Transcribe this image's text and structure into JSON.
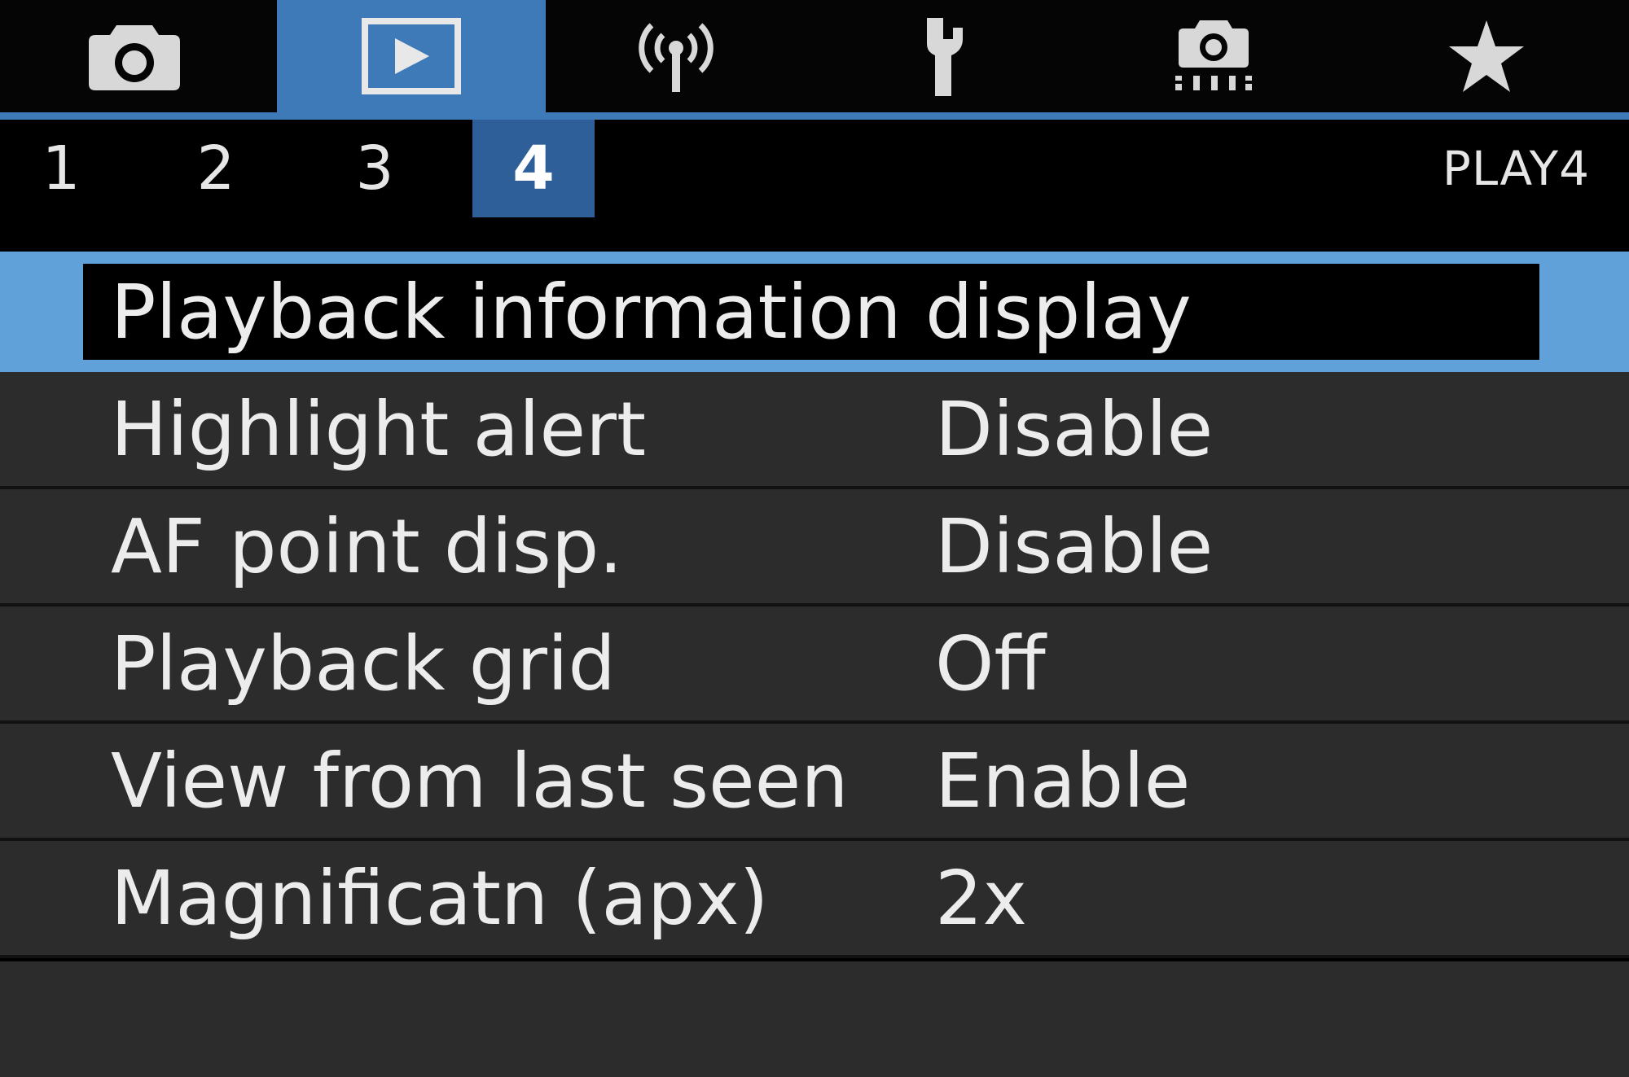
{
  "colors": {
    "accent_blue": "#3f7ab8",
    "page_tab_active": "#2e5f98",
    "selection_highlight": "#5fa1d8",
    "row_background": "#2c2c2c",
    "text": "#ececec"
  },
  "category_tabs": [
    {
      "icon": "camera-icon",
      "active": false
    },
    {
      "icon": "playback-icon",
      "active": true
    },
    {
      "icon": "wireless-icon",
      "active": false
    },
    {
      "icon": "wrench-icon",
      "active": false
    },
    {
      "icon": "custom-camera-icon",
      "active": false
    },
    {
      "icon": "star-icon",
      "active": false
    }
  ],
  "page_tabs": {
    "items": [
      "1",
      "2",
      "3",
      "4"
    ],
    "selected": "4",
    "label": "PLAY4"
  },
  "menu": {
    "selected_index": 0,
    "items": [
      {
        "label": "Playback information display",
        "value": ""
      },
      {
        "label": "Highlight alert",
        "value": "Disable"
      },
      {
        "label": "AF point disp.",
        "value": "Disable"
      },
      {
        "label": "Playback grid",
        "value": "Off"
      },
      {
        "label": "View from last seen",
        "value": "Enable"
      },
      {
        "label": "Magnificatn (apx)",
        "value": "2x"
      }
    ]
  }
}
